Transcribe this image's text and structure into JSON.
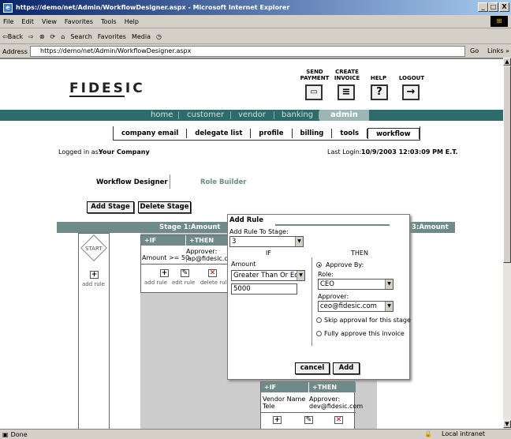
{
  "window": {
    "title": "https://demo/net/Admin/WorkflowDesigner.aspx - Microsoft Internet Explorer",
    "min": "_",
    "max": "□",
    "close": "X"
  },
  "menu": [
    "File",
    "Edit",
    "View",
    "Favorites",
    "Tools",
    "Help"
  ],
  "toolbar": {
    "back": "⇦Back",
    "fwd": "⇨",
    "stop": "⊗",
    "refresh": "⟳",
    "home": "⌂",
    "search": "Search",
    "favorites": "Favorites",
    "media": "Media",
    "history": "◷"
  },
  "address": {
    "label": "Address",
    "url": "https://demo/net/Admin/WorkflowDesigner.aspx",
    "go": "Go",
    "links": "Links »"
  },
  "header": {
    "logo": "FIDESIC",
    "send_payment": "SEND PAYMENT",
    "create_invoice": "CREATE INVOICE",
    "help": "HELP",
    "logout": "LOGOUT",
    "help_glyph": "?",
    "logout_glyph": "→"
  },
  "nav": {
    "home": "home",
    "customer": "customer",
    "vendor": "vendor",
    "banking": "banking",
    "admin": "admin"
  },
  "subnav": {
    "company_email": "company email",
    "delegate_list": "delegate list",
    "profile": "profile",
    "billing": "billing",
    "tools": "tools",
    "workflow": "workflow"
  },
  "session": {
    "logged_in_label": "Logged in as:",
    "company": "Your Company",
    "last_login_label": "Last Login:",
    "last_login": "10/9/2003 12:03:09 PM E.T."
  },
  "tabs": {
    "designer": "Workflow Designer",
    "builder": "Role Builder"
  },
  "buttons": {
    "add_stage": "Add Stage",
    "delete_stage": "Delete Stage"
  },
  "stage": {
    "title": "Stage 1:Amount",
    "title3": "3:Amount",
    "start": "START",
    "add_rule": "add rule"
  },
  "rule1": {
    "if": "IF",
    "then": "THEN",
    "condition": "Amount >= 50",
    "approver": "Approver:",
    "approver_email": "ap@fidesic.com",
    "add_rule": "add rule",
    "edit_rule": "edit rule",
    "delete_rule": "delete rule"
  },
  "rule2": {
    "if": "IF",
    "then": "THEN",
    "condition": "Vendor Name Tele",
    "approver": "Approver:",
    "approver_email": "dev@fidesic.com"
  },
  "dialog": {
    "title": "Add Rule",
    "stage_label": "Add Rule To Stage:",
    "stage_value": "3",
    "if_label": "IF",
    "then_label": "THEN",
    "field_label": "Amount",
    "operator": "Greater Than Or Equa",
    "amount": "5000",
    "approve_by": "Approve By:",
    "role_label": "Role:",
    "role": "CEO",
    "approver_label": "Approver:",
    "approver": "ceo@fidesic.com",
    "skip": "Skip approval for this stage",
    "fully": "Fully approve this invoice",
    "cancel": "cancel",
    "add": "Add"
  },
  "status": {
    "done": "Done",
    "zone": "Local intranet"
  }
}
